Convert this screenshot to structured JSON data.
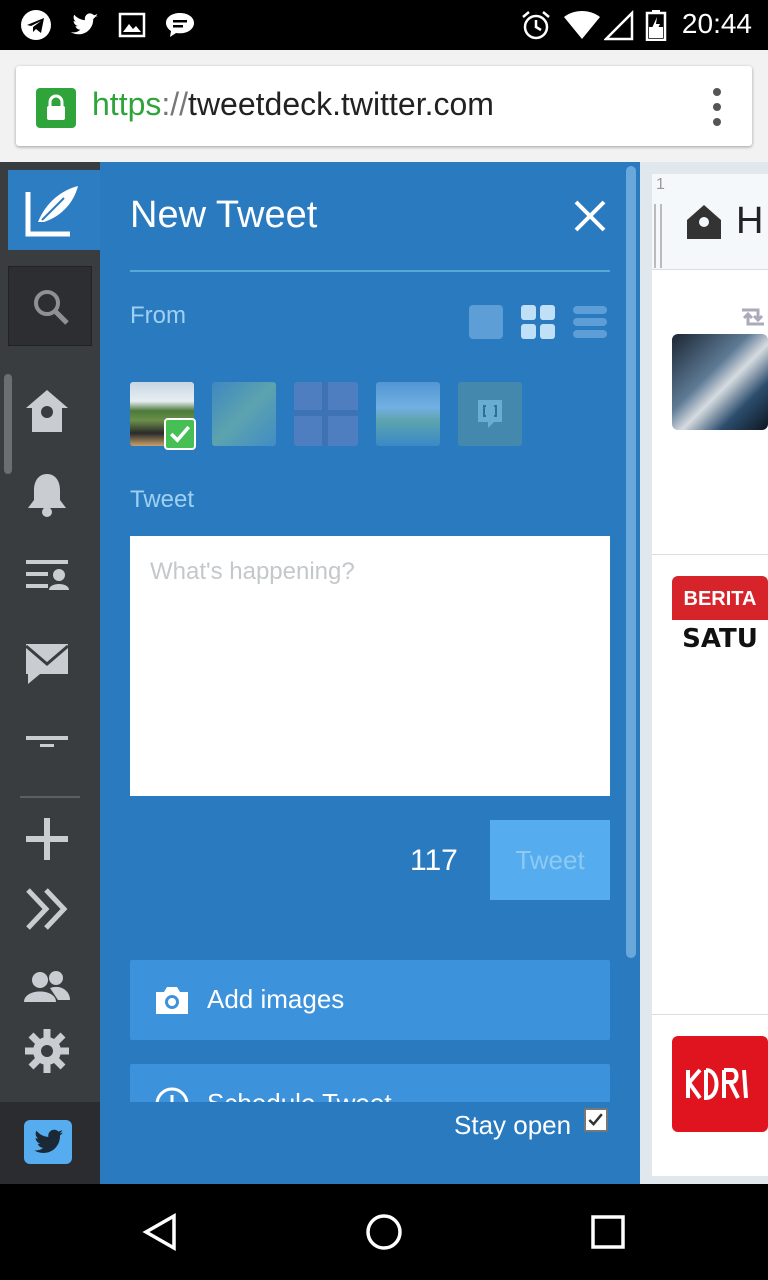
{
  "status_bar": {
    "time": "20:44",
    "icons": [
      "telegram-icon",
      "twitter-icon",
      "gallery-icon",
      "chat-icon",
      "alarm-icon",
      "wifi-icon",
      "signal-icon",
      "battery-icon"
    ]
  },
  "browser": {
    "url_protocol": "https",
    "url_separator": "://",
    "url_host": "tweetdeck.twitter.com",
    "menu_icon": "overflow-menu-icon"
  },
  "nav": {
    "items": [
      "compose-icon",
      "search-icon",
      "home-icon",
      "notifications-icon",
      "lists-icon",
      "messages-icon",
      "filter-icon",
      "add-column-icon",
      "collapse-icon",
      "accounts-icon",
      "settings-icon",
      "twitter-logo-icon"
    ]
  },
  "compose": {
    "title": "New Tweet",
    "from_label": "From",
    "tweet_label": "Tweet",
    "placeholder": "What's happening?",
    "char_count": "117",
    "tweet_button": "Tweet",
    "add_images": "Add images",
    "schedule_tweet": "Schedule Tweet",
    "stay_open": "Stay open"
  },
  "column": {
    "number": "1",
    "title": "H"
  },
  "colors": {
    "panel": "#2a7ac0",
    "accent": "#55acee",
    "nav": "#3a3d40"
  }
}
